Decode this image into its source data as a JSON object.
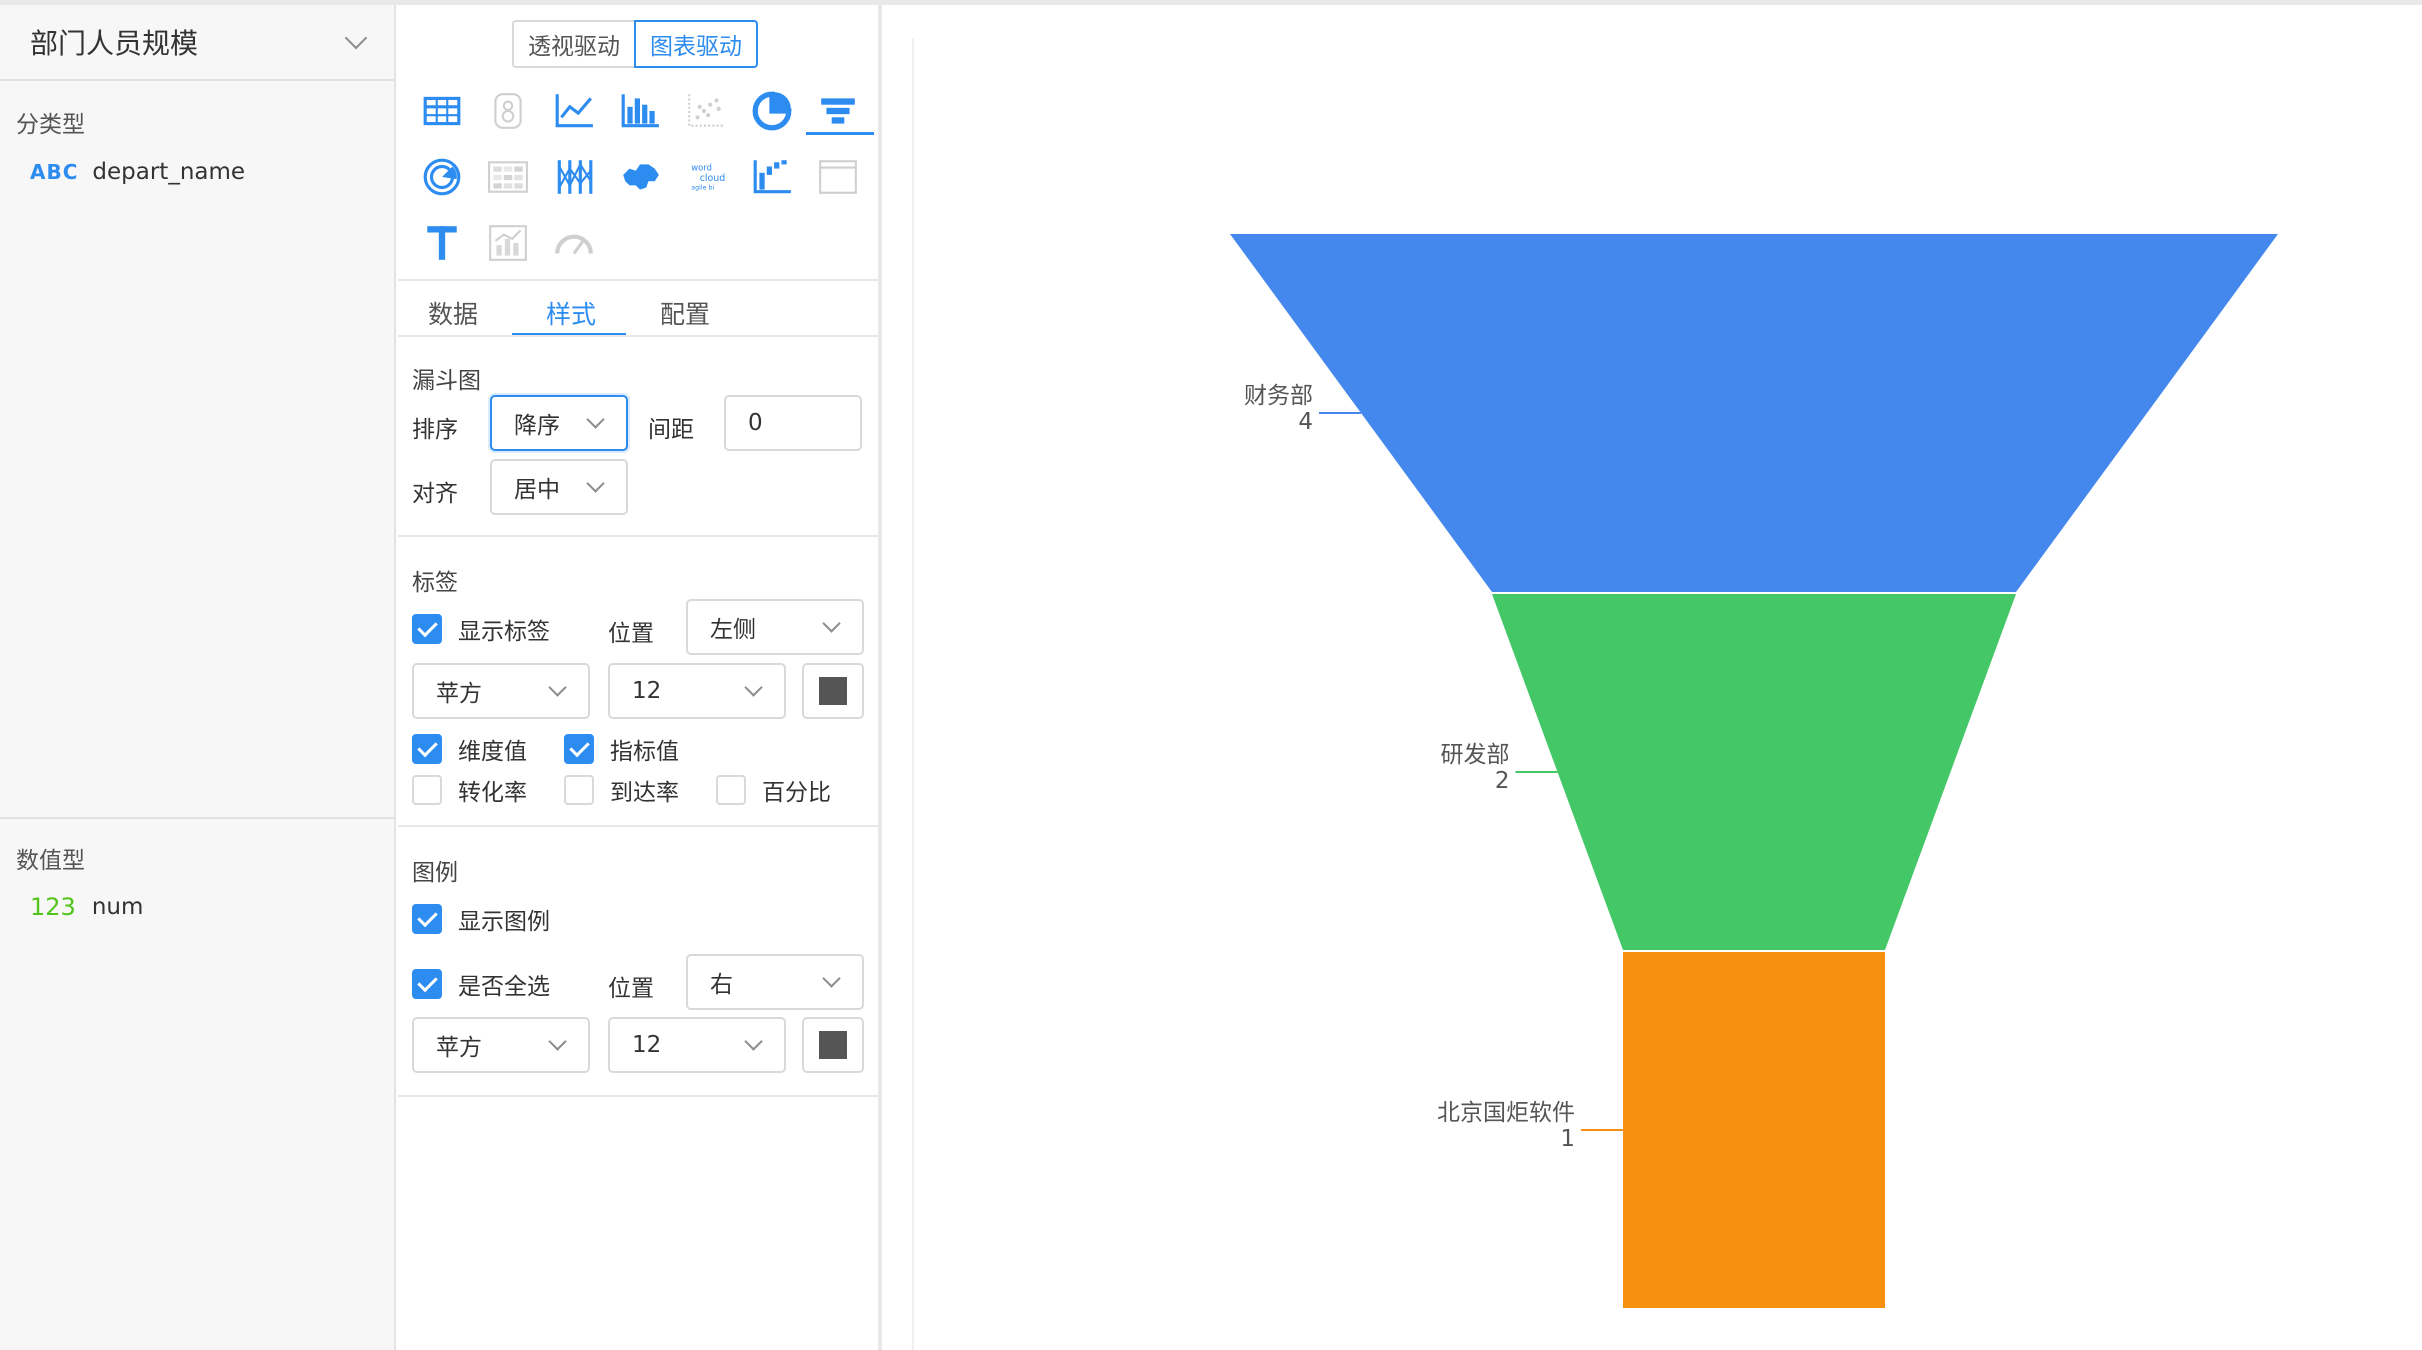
{
  "dataset": {
    "title": "部门人员规模"
  },
  "fields": {
    "dimension_title": "分类型",
    "dimension_items": [
      {
        "type_tag": "ABC",
        "name": "depart_name"
      }
    ],
    "measure_title": "数值型",
    "measure_items": [
      {
        "type_tag": "123",
        "name": "num"
      }
    ]
  },
  "mode": {
    "pivot_label": "透视驱动",
    "chart_label": "图表驱动",
    "active": "图表驱动"
  },
  "chart_types": [
    "table-icon",
    "number-card-icon",
    "line-chart-icon",
    "bar-chart-icon",
    "scatter-icon",
    "pie-chart-icon",
    "funnel-icon",
    "radar-icon",
    "heatmap-icon",
    "parallel-icon",
    "china-map-icon",
    "word-cloud-icon",
    "waterfall-icon",
    "frame-icon",
    "text-icon",
    "combo-chart-icon",
    "gauge-icon"
  ],
  "tabs": {
    "data": "数据",
    "style": "样式",
    "config": "配置",
    "active": "样式"
  },
  "funnel_settings": {
    "title": "漏斗图",
    "sort_label": "排序",
    "sort_value": "降序",
    "gap_label": "间距",
    "gap_value": "0",
    "align_label": "对齐",
    "align_value": "居中"
  },
  "label_settings": {
    "title": "标签",
    "show_label": "显示标签",
    "show_label_checked": true,
    "position_label": "位置",
    "position_value": "左侧",
    "font_value": "苹方",
    "size_value": "12",
    "color": "#555555",
    "dimension_value": "维度值",
    "dimension_checked": true,
    "measure_value": "指标值",
    "measure_checked": true,
    "conversion": "转化率",
    "conversion_checked": false,
    "arrival": "到达率",
    "arrival_checked": false,
    "percent": "百分比",
    "percent_checked": false
  },
  "legend_settings": {
    "title": "图例",
    "show_legend": "显示图例",
    "show_legend_checked": true,
    "select_all": "是否全选",
    "select_all_checked": true,
    "position_label": "位置",
    "position_value": "右",
    "font_value": "苹方",
    "size_value": "12",
    "color": "#555555"
  },
  "chart_data": {
    "type": "funnel",
    "categories": [
      "财务部",
      "研发部",
      "北京国炬软件"
    ],
    "values": [
      4,
      2,
      1
    ],
    "colors": [
      "#4488ee",
      "#44c766",
      "#f7900f"
    ],
    "label_position": "left",
    "sort": "descending",
    "align": "center"
  }
}
